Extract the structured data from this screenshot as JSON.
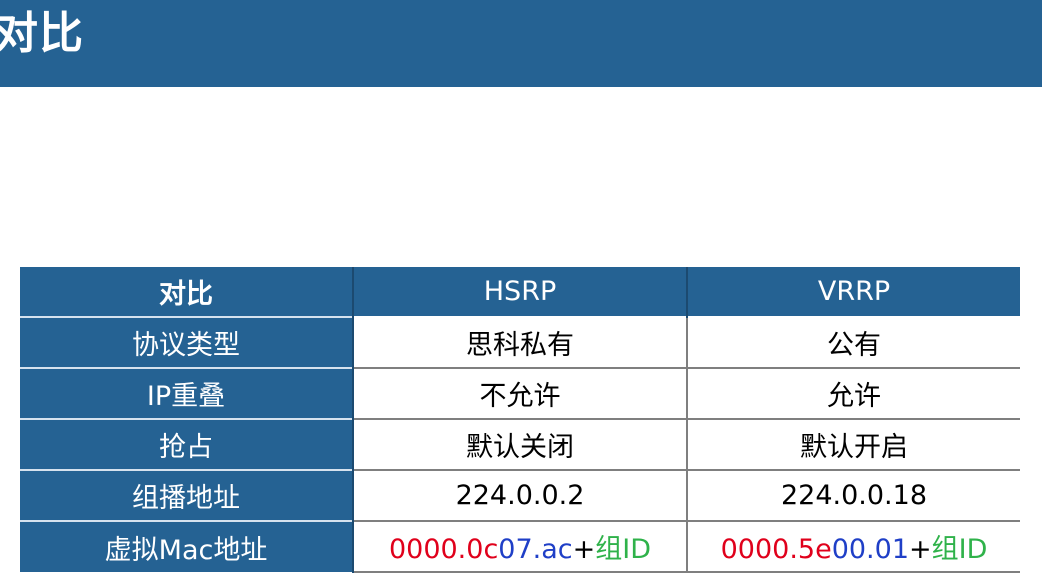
{
  "title": "对比",
  "colors": {
    "header_bg": "#256293",
    "red": "#e0001b",
    "blue": "#1f3fc7",
    "green": "#2fb24a",
    "black": "#000000"
  },
  "table": {
    "headers": [
      "对比",
      "HSRP",
      "VRRP"
    ],
    "rows": [
      {
        "label": "协议类型",
        "hsrp": "思科私有",
        "vrrp": "公有"
      },
      {
        "label": "IP重叠",
        "hsrp": "不允许",
        "vrrp": "允许"
      },
      {
        "label": "抢占",
        "hsrp": "默认关闭",
        "vrrp": "默认开启"
      },
      {
        "label": "组播地址",
        "hsrp": "224.0.0.2",
        "vrrp": "224.0.0.18"
      }
    ],
    "mac_row": {
      "label": "虚拟Mac地址",
      "hsrp_segments": [
        {
          "text": "0000.0c",
          "color": "#e0001b"
        },
        {
          "text": "07.ac",
          "color": "#1f3fc7"
        },
        {
          "text": "+",
          "color": "#000000"
        },
        {
          "text": "组ID",
          "color": "#2fb24a"
        }
      ],
      "vrrp_segments": [
        {
          "text": "0000.5e",
          "color": "#e0001b"
        },
        {
          "text": "00.01",
          "color": "#1f3fc7"
        },
        {
          "text": "+",
          "color": "#000000"
        },
        {
          "text": "组ID",
          "color": "#2fb24a"
        }
      ]
    }
  }
}
